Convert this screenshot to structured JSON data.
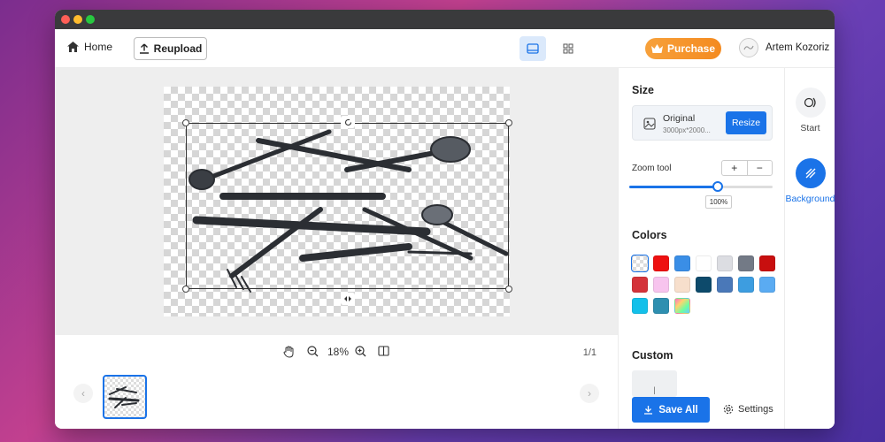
{
  "topbar": {
    "home_label": "Home",
    "reupload_label": "Reupload",
    "purchase_label": "Purchase",
    "user_name": "Artem Kozoriz"
  },
  "canvas": {
    "zoom_percent": "18%",
    "pages": "1/1"
  },
  "panel": {
    "size_title": "Size",
    "size_option": "Original",
    "size_dims": "3000px*2000...",
    "resize_label": "Resize",
    "zoom_tool_label": "Zoom tool",
    "zoom_plus": "+",
    "zoom_minus": "−",
    "zoom_value": "100%",
    "zoom_fraction": 0.62,
    "colors_title": "Colors",
    "colors": [
      "transparent",
      "#ee1111",
      "#3a8ee6",
      "#ffffff",
      "#dcdde2",
      "#737a86",
      "#c80f0f",
      "#d4333a",
      "#f7c4ee",
      "#f7dfcc",
      "#0d4a6b",
      "#4a78b8",
      "#3d9de0",
      "#5aabf2",
      "#13c0ea",
      "#2e8fb0",
      "gradient"
    ],
    "custom_title": "Custom",
    "custom_placeholder": "|",
    "save_all_label": "Save All",
    "settings_label": "Settings"
  },
  "rail": {
    "start_label": "Start",
    "background_label": "Background"
  },
  "accent": "#1a73e8"
}
